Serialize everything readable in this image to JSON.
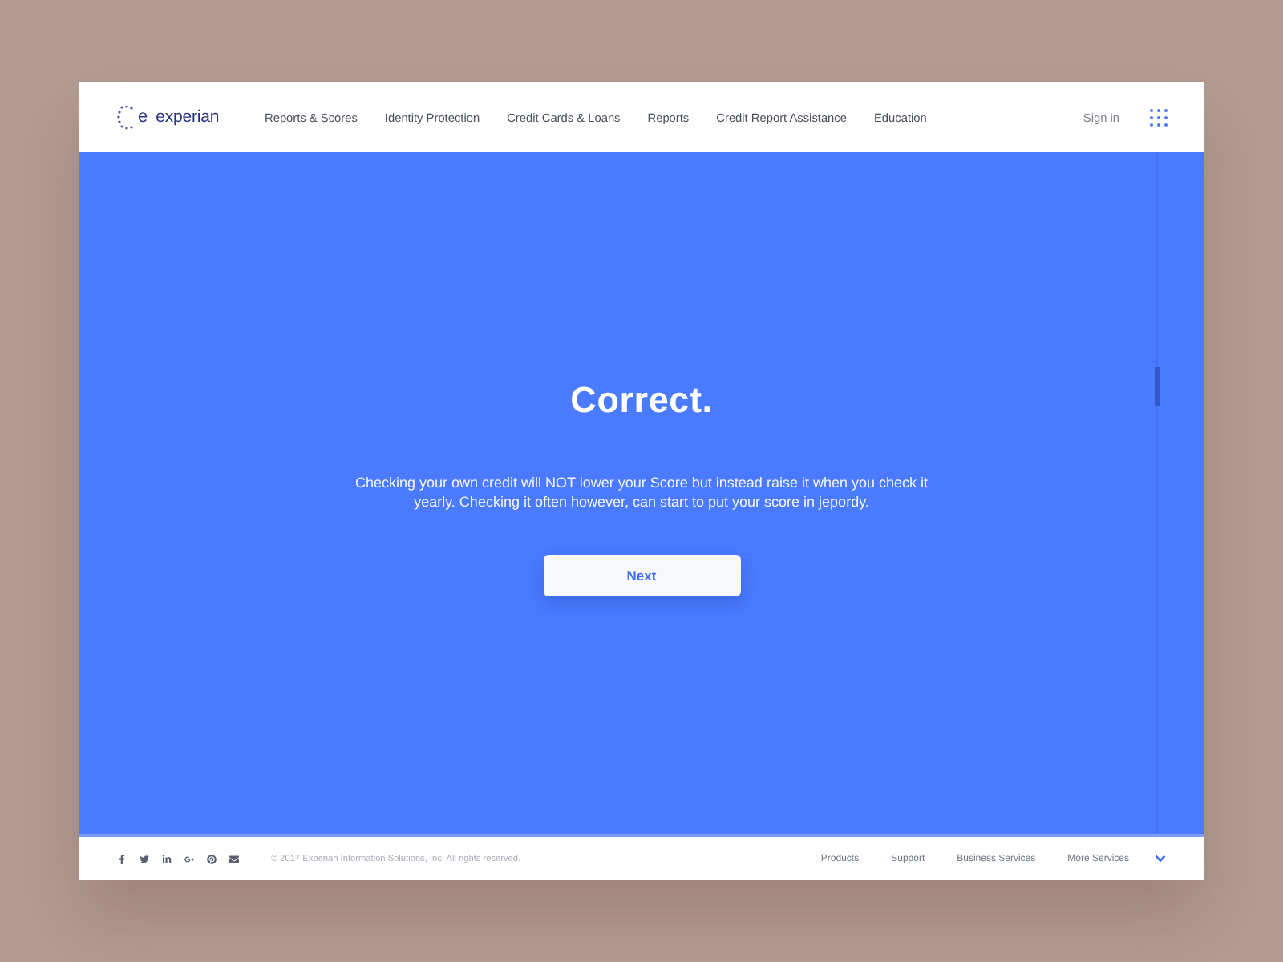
{
  "header": {
    "logo": {
      "letter": "e",
      "wordmark": "experian"
    },
    "nav": [
      "Reports & Scores",
      "Identity Protection",
      "Credit Cards & Loans",
      "Reports",
      "Credit Report Assistance",
      "Education"
    ],
    "sign_in": "Sign in"
  },
  "result": {
    "title": "Correct.",
    "message": "Checking your own credit will NOT lower your Score but instead raise it when you check it yearly. Checking it often however, can start to put your score in jepordy.",
    "button": "Next"
  },
  "footer": {
    "copyright": "© 2017 Experian Information Solutions, Inc. All rights reserved.",
    "links": [
      "Products",
      "Support",
      "Business Services",
      "More Services"
    ]
  }
}
